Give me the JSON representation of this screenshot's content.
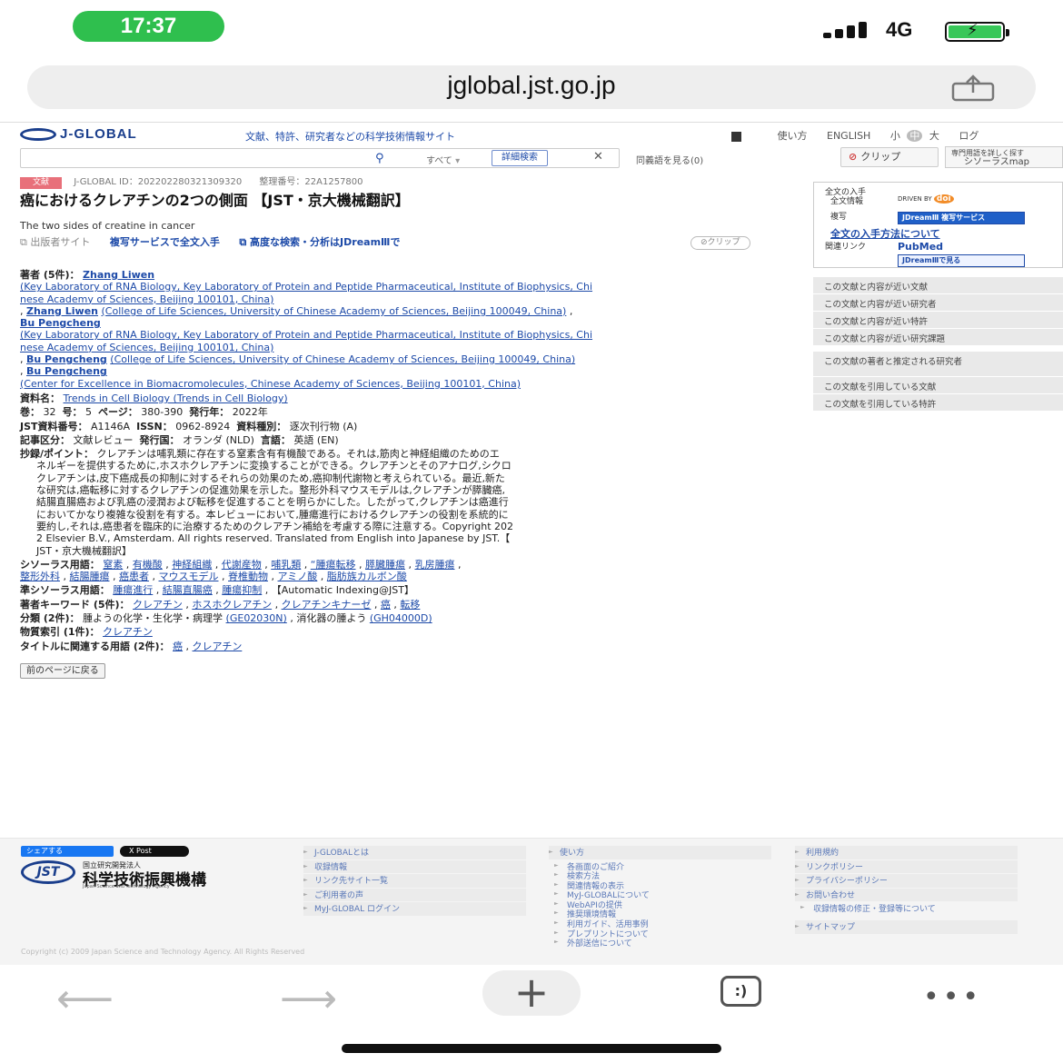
{
  "status_bar": {
    "time": "17:37",
    "network": "4G"
  },
  "url_bar": {
    "url": "jglobal.jst.go.jp"
  },
  "site_header": {
    "logo": "J-GLOBAL",
    "tagline": "文献、特許、研究者などの科学技術情報サイト",
    "nav": [
      "使い方",
      "ENGLISH",
      "小",
      "中",
      "大",
      "ログ"
    ]
  },
  "search": {
    "scope": "すべて",
    "advanced_label": "詳細検索",
    "synonym_label": "同義語を見る(0)",
    "clip_label": "クリップ",
    "thesaurus_label_1": "専門用語を詳しく探す",
    "thesaurus_label_2": "シソーラスmap"
  },
  "article": {
    "type_tag": "文献",
    "id_label": "J-GLOBAL ID：202202280321309320",
    "ref_label": "整理番号：22A1257800",
    "title_ja": "癌におけるクレアチンの2つの側面 【JST・京大機械翻訳】",
    "title_en": "The two sides of creatine in cancer",
    "publisher_site": "出版者サイト",
    "copy_service_link": "複写サービスで全文入手",
    "advanced_analysis_link": "高度な検索・分析はJDreamⅢで",
    "clip_label": "クリップ",
    "authors_label": "著者 (5件)：",
    "authors": [
      {
        "name": "Zhang Liwen",
        "affil": "(Key Laboratory of RNA Biology, Key Laboratory of Protein and Peptide Pharmaceutical, Institute of Biophysics, Chi",
        "affil2": "nese Academy of Sciences, Beijing 100101, China)"
      },
      {
        "name": "Zhang Liwen",
        "affil": "(College of Life Sciences, University of Chinese Academy of Sciences, Beijing 100049, China)"
      },
      {
        "name": "Bu Pengcheng",
        "affil": "(Key Laboratory of RNA Biology, Key Laboratory of Protein and Peptide Pharmaceutical, Institute of Biophysics, Chi",
        "affil2": "nese Academy of Sciences, Beijing 100101, China)"
      },
      {
        "name": "Bu Pengcheng",
        "affil": "(College of Life Sciences, University of Chinese Academy of Sciences, Beijing 100049, China)"
      },
      {
        "name": "Bu Pengcheng",
        "affil": "(Center for Excellence in Biomacromolecules, Chinese Academy of Sciences, Beijing 100101, China)"
      }
    ],
    "journal_label": "資料名：",
    "journal": "Trends in Cell Biology (Trends in Cell Biology)",
    "volume_line_label_vol": "巻：",
    "volume": "32",
    "issue_label": "号：",
    "issue": "5",
    "page_label": "ページ：",
    "pages": "380-390",
    "year_label": "発行年：",
    "year": "2022年",
    "jst_no_label": "JST資料番号：",
    "jst_no": "A1146A",
    "issn_label": "ISSN：",
    "issn": "0962-8924",
    "doc_type_label": "資料種別：",
    "doc_type": "逐次刊行物 (A)",
    "article_type_label": "記事区分：",
    "article_type": "文献レビュー",
    "country_label": "発行国：",
    "country": "オランダ (NLD)",
    "language_label": "言語：",
    "language": "英語 (EN)",
    "abstract_label": "抄録/ポイント：",
    "abstract_lines": [
      "クレアチンは哺乳類に存在する窒素含有有機酸である。それは,筋肉と神経組織のためのエ",
      "ネルギーを提供するために,ホスホクレアチンに変換することができる。クレアチンとそのアナログ,シクロ",
      "クレアチンは,皮下癌成長の抑制に対するそれらの効果のため,癌抑制代謝物と考えられている。最近,新た",
      "な研究は,癌転移に対するクレアチンの促進効果を示した。整形外科マウスモデルは,クレアチンが膵臓癌,",
      "結腸直腸癌および乳癌の浸潤および転移を促進することを明らかにした。したがって,クレアチンは癌進行",
      "においてかなり複雑な役割を有する。本レビューにおいて,腫瘍進行におけるクレアチンの役割を系統的に",
      "要約し,それは,癌患者を臨床的に治療するためのクレアチン補給を考慮する際に注意する。Copyright 202",
      "2 Elsevier B.V., Amsterdam. All rights reserved. Translated from English into Japanese by JST.【",
      "JST・京大機械翻訳】"
    ],
    "thesaurus_label": "シソーラス用語：",
    "thesaurus_terms_1": [
      "窒素",
      "有機酸",
      "神経組織",
      "代謝産物",
      "哺乳類",
      "“腫瘍転移",
      "膵臓腫瘍",
      "乳房腫瘍"
    ],
    "thesaurus_terms_2": [
      "整形外科",
      "結腸腫瘍",
      "癌患者",
      "マウスモデル",
      "脊椎動物",
      "アミノ酸",
      "脂肪族カルボン酸"
    ],
    "quasi_label": "準シソーラス用語：",
    "quasi_terms": [
      "腫瘍進行",
      "結腸直腸癌",
      "腫瘍抑制"
    ],
    "quasi_auto": "【Automatic Indexing@JST】",
    "keywords_label": "著者キーワード (5件)：",
    "keywords": [
      "クレアチン",
      "ホスホクレアチン",
      "クレアチンキナーゼ",
      "癌",
      "転移"
    ],
    "classification_label": "分類 (2件)：",
    "class_1": "腫ようの化学・生化学・病理学",
    "class_1_code": "(GE02030N)",
    "class_2": "消化器の腫よう",
    "class_2_code": "(GH04000D)",
    "substance_label": "物質索引 (1件)：",
    "substance": "クレアチン",
    "title_terms_label": "タイトルに関連する用語 (2件)：",
    "title_terms": [
      "癌",
      "クレアチン"
    ],
    "back_button": "前のページに戻る"
  },
  "sidebar": {
    "fulltext_label": "全文の入手",
    "fulltext_info": "全文情報",
    "copy_label": "複写",
    "doi_text": "DRIVEN BY",
    "doi_mark": "doi",
    "jdream_copy": "JDreamⅢ 複写サービス",
    "how_to_get": "全文の入手方法について",
    "related_links": "関連リンク",
    "pubmed": "PubMed",
    "jdream_view": "JDreamⅢで見る",
    "items": [
      "この文献と内容が近い文献",
      "この文献と内容が近い研究者",
      "この文献と内容が近い特許",
      "この文献と内容が近い研究課題",
      "この文献の著者と推定される研究者",
      "この文献を引用している文献",
      "この文献を引用している特許"
    ]
  },
  "footer": {
    "share_fb": "シェアする",
    "share_x": "X Post",
    "org_small": "国立研究開発法人",
    "org_name": "科学技術振興機構",
    "org_en": "Japan Science and Technology Agency",
    "jst_mark": "JST",
    "col1": [
      "J-GLOBALとは",
      "収録情報",
      "リンク先サイト一覧",
      "ご利用者の声",
      "MyJ-GLOBAL ログイン"
    ],
    "col2_head": "使い方",
    "col2_subs": [
      "各画面のご紹介",
      "検索方法",
      "関連情報の表示",
      "MyJ-GLOBALについて",
      "WebAPIの提供",
      "推奨環境情報",
      "利用ガイド、活用事例",
      "プレプリントについて",
      "外部送信について"
    ],
    "col3": [
      "利用規約",
      "リンクポリシー",
      "プライバシーポリシー",
      "お問い合わせ"
    ],
    "col3_sub": "収録情報の修正・登録等について",
    "col3_last": "サイトマップ",
    "copyright": "Copyright (c) 2009 Japan Science and Technology Agency. All Rights Reserved"
  },
  "toolbar": {
    "tabs_glyph": ":)"
  }
}
